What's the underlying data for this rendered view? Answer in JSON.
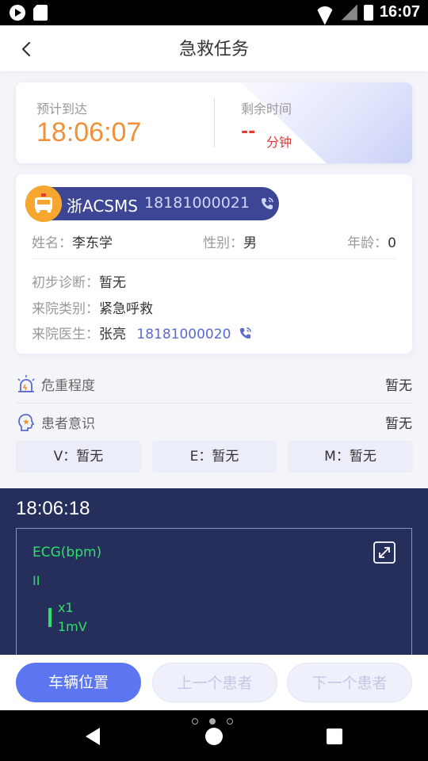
{
  "status_bar": {
    "time": "16:07"
  },
  "header": {
    "title": "急救任务"
  },
  "arrival": {
    "eta_label": "预计到达",
    "eta_time": "18:06:07",
    "remaining_label": "剩余时间",
    "remaining_value": "--",
    "remaining_unit": "分钟"
  },
  "vehicle": {
    "plate": "浙ACSMS",
    "phone": "18181000021"
  },
  "patient": {
    "name_label": "姓名：",
    "name": "李东学",
    "gender_label": "性别：",
    "gender": "男",
    "age_label": "年龄：",
    "age": "0",
    "diagnosis_label": "初步诊断：",
    "diagnosis": "暂无",
    "category_label": "来院类别：",
    "category": "紧急呼救",
    "doctor_label": "来院医生：",
    "doctor": "张亮",
    "doctor_phone": "18181000020"
  },
  "severity": {
    "label": "危重程度",
    "value": "暂无"
  },
  "consciousness": {
    "label": "患者意识",
    "value": "暂无"
  },
  "gcs": {
    "v": "V：暂无",
    "e": "E：暂无",
    "m": "M：暂无"
  },
  "ecg": {
    "time": "18:06:18",
    "label": "ECG(bpm)",
    "lead": "II",
    "gain": "x1",
    "scale": "1mV"
  },
  "actions": {
    "vehicle_location": "车辆位置",
    "prev_patient": "上一个患者",
    "next_patient": "下一个患者"
  },
  "colors": {
    "accent": "#5b76f0",
    "eta": "#f0913a",
    "plate_bg": "#3c4694",
    "ecg_bg": "#262e5c",
    "ecg_trace": "#2ee06a",
    "warning": "#e53935"
  }
}
